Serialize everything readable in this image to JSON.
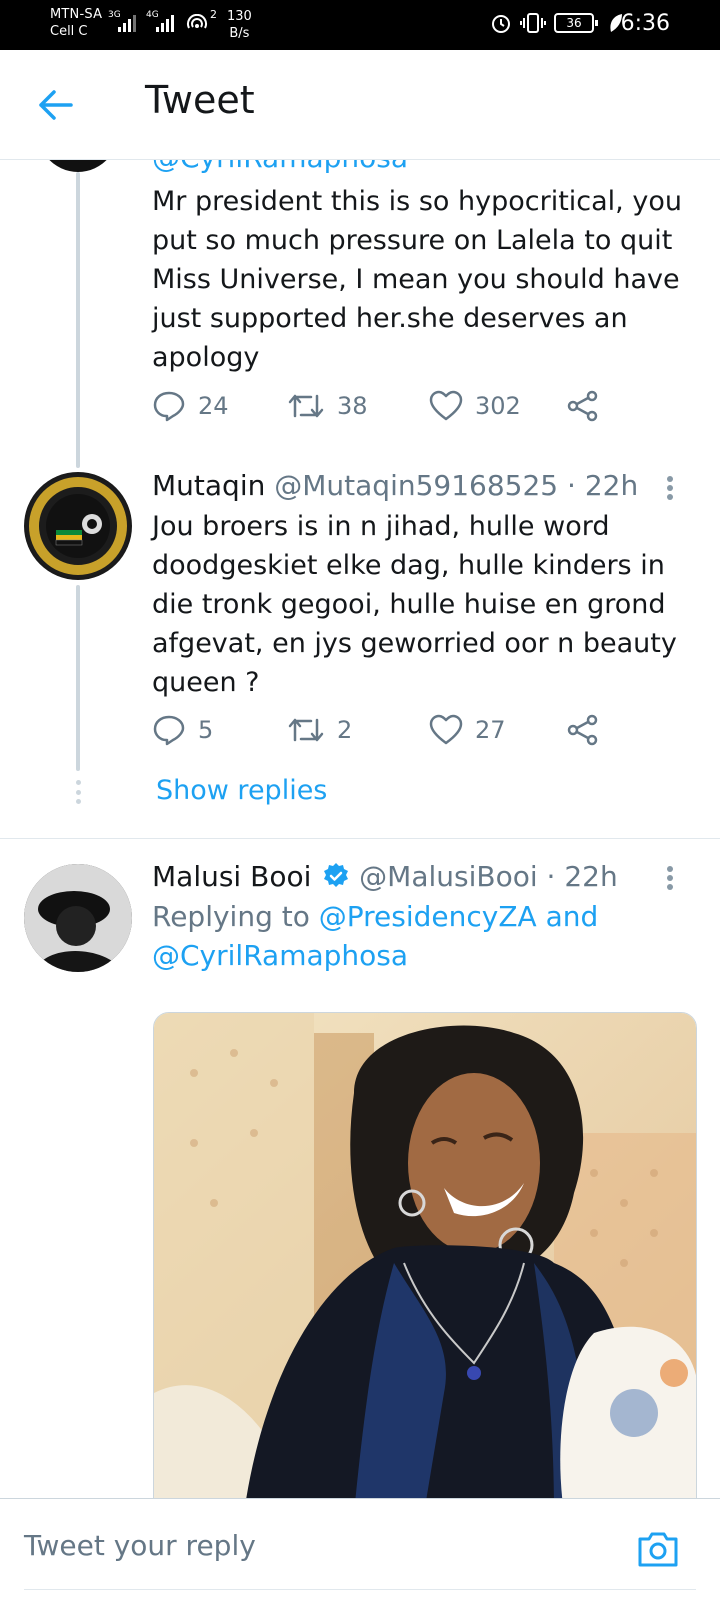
{
  "status_bar": {
    "carrier_name": "MTN-SA",
    "carrier_sub": "Cell C",
    "sig1_type": "3G",
    "sig2_type": "4G",
    "hotspot_count": "2",
    "speed_value": "130",
    "speed_unit": "B/s",
    "battery": "36",
    "time": "6:36",
    "icons": [
      "alarm-icon",
      "vibrate-icon",
      "battery-icon",
      "leaf-icon"
    ]
  },
  "header": {
    "title": "Tweet"
  },
  "tweets": [
    {
      "partial_reply_to": "@CyrilRamaphosa",
      "text": "Mr president this is so hypocritical, you put so much pressure on Lalela to quit Miss Universe, I mean you  should have just supported her.she deserves an apology",
      "replies": "24",
      "retweets": "38",
      "likes": "302"
    },
    {
      "name": "Mutaqin",
      "handle": "@Mutaqin59168525",
      "time": "· 22h",
      "text": "Jou broers is in n jihad, hulle word doodgeskiet elke dag, hulle kinders in die tronk gegooi, hulle huise en grond afgevat, en jys geworried oor n beauty queen ?",
      "replies": "5",
      "retweets": "2",
      "likes": "27",
      "show_replies": "Show replies"
    },
    {
      "name": "Malusi Booi",
      "handle": "@MalusiBooi",
      "time": "· 22h",
      "replying_prefix": "Replying to",
      "replying_to_1": "@PresidencyZA",
      "replying_and": "and",
      "replying_to_2": "@CyrilRamaphosa"
    }
  ],
  "reply_bar": {
    "placeholder": "Tweet your reply"
  },
  "colors": {
    "accent": "#1da1f2",
    "secondary_text": "#657786",
    "thread_line": "#ccd6dd"
  }
}
